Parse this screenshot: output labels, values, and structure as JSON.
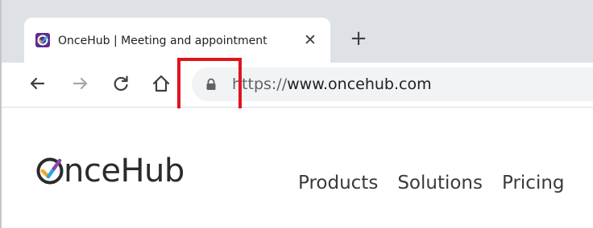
{
  "browser": {
    "tab": {
      "title": "OnceHub | Meeting and appointment",
      "favicon": "oncehub-favicon-icon",
      "close_label": "✕"
    },
    "new_tab_label": "+",
    "toolbar": {
      "back_icon": "back-arrow-icon",
      "forward_icon": "forward-arrow-icon",
      "reload_icon": "reload-icon",
      "home_icon": "home-icon"
    },
    "address_bar": {
      "lock_icon": "lock-icon",
      "url_scheme": "https://",
      "url_host": "www.oncehub.com"
    },
    "highlight_color": "#e0141e"
  },
  "site": {
    "logo_text": "nceHub",
    "logo_letter": "O",
    "nav": [
      {
        "label": "Products"
      },
      {
        "label": "Solutions"
      },
      {
        "label": "Pricing"
      }
    ]
  }
}
